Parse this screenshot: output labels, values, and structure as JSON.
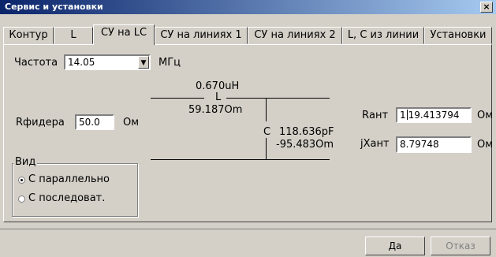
{
  "window": {
    "title": "Сервис и установки",
    "close_glyph": "×"
  },
  "tabs": [
    {
      "label": "Контур"
    },
    {
      "label": "L"
    },
    {
      "label": "СУ на LC"
    },
    {
      "label": "СУ на линиях 1"
    },
    {
      "label": "СУ на линиях 2"
    },
    {
      "label": "L, C из линии"
    },
    {
      "label": "Установки"
    }
  ],
  "form": {
    "freq_label": "Частота",
    "freq_value": "14.05",
    "freq_unit": "МГц",
    "dropdown_glyph": "▼",
    "rfeeder_label": "Rфидера",
    "rfeeder_value": "50.0",
    "rfeeder_unit": "Ом",
    "rant_label": "Rант",
    "rant_value_before": "1",
    "rant_value_after": "19.413794",
    "rant_unit": "Ом",
    "xant_label": "jXант",
    "xant_value": "8.79748",
    "xant_unit": "Ом"
  },
  "circuit": {
    "l_value": "0.670uH",
    "l_label": "L",
    "l_reactance": "59.187Om",
    "c_label": "C",
    "c_value": "118.636pF",
    "c_reactance": "-95.483Om"
  },
  "view_group": {
    "legend": "Вид",
    "options": [
      {
        "label": "С параллельно",
        "selected": true
      },
      {
        "label": "С последоват.",
        "selected": false
      }
    ]
  },
  "buttons": {
    "ok": "Да",
    "cancel": "Отказ"
  }
}
